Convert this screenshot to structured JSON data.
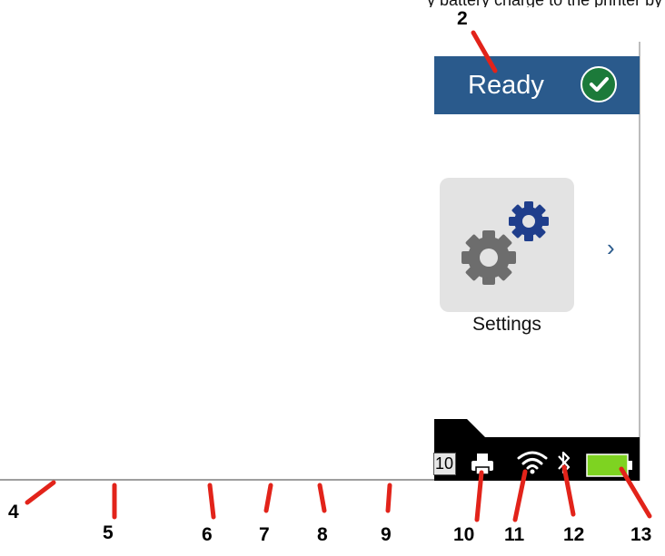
{
  "top_caption": "y battery charge to the printer by",
  "header": {
    "status_label": "Ready",
    "status_color": "#2a5a8c",
    "check_color": "#1c7a3a"
  },
  "main": {
    "settings_label": "Settings",
    "settings_icon": "gear-icon",
    "chevron_icon": "chevron-right-icon",
    "chevron_glyph": "›"
  },
  "status_bar": {
    "page_number": "10",
    "printer_icon": "printer-icon",
    "wifi_icon": "wifi-icon",
    "bluetooth_icon": "bluetooth-icon",
    "battery_icon": "battery-icon",
    "battery_level": 1.0,
    "battery_color": "#7ed321"
  },
  "callouts": {
    "top": "2",
    "items": [
      "4",
      "5",
      "6",
      "7",
      "8",
      "9",
      "10",
      "11",
      "12",
      "13"
    ]
  },
  "colors": {
    "callout_line": "#e2231a"
  }
}
